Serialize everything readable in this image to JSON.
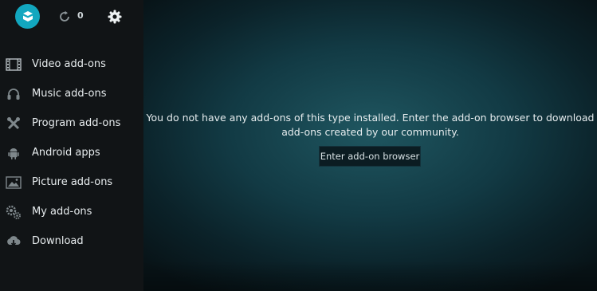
{
  "header": {
    "update_count": "0",
    "icons": {
      "logo": "open-box-icon",
      "refresh": "refresh-icon",
      "settings": "gear-icon"
    }
  },
  "sidebar": {
    "items": [
      {
        "label": "Video add-ons",
        "icon": "film-icon"
      },
      {
        "label": "Music add-ons",
        "icon": "headphones-icon"
      },
      {
        "label": "Program add-ons",
        "icon": "tools-icon"
      },
      {
        "label": "Android apps",
        "icon": "android-icon"
      },
      {
        "label": "Picture add-ons",
        "icon": "picture-icon"
      },
      {
        "label": "My add-ons",
        "icon": "gears-icon"
      },
      {
        "label": "Download",
        "icon": "cloud-download-icon"
      }
    ]
  },
  "main": {
    "message_line1": "You do not have any add-ons of this type installed. Enter the add-on browser to download",
    "message_line2": "add-ons created by our community.",
    "browser_button": "Enter add-on browser"
  },
  "colors": {
    "accent": "#12a7bf",
    "sidebar_bg": "#111416",
    "text": "#e7ecee"
  }
}
